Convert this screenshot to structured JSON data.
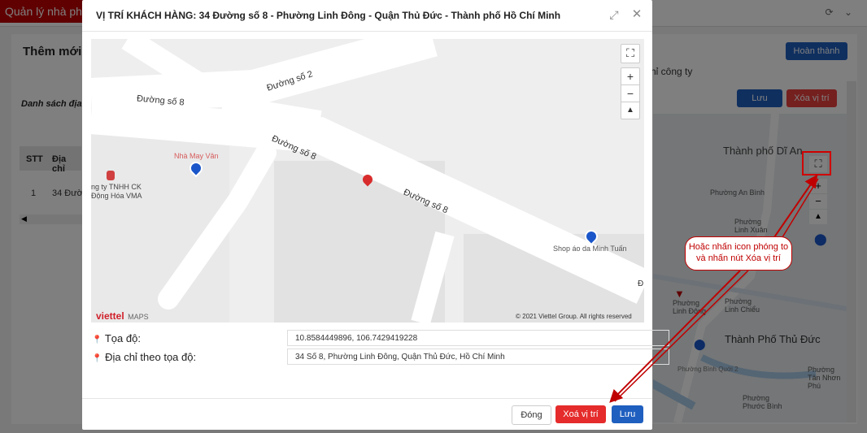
{
  "background": {
    "brand": "Quản lý nhà phân",
    "page_title": "Thêm mới",
    "done_button": "Hoàn thành",
    "company_text": "hỉ công ty",
    "list_label": "Danh sách địa",
    "save_button": "Lưu",
    "delete_button": "Xóa vị trí",
    "table": {
      "headers": [
        "STT",
        "Địa chỉ"
      ],
      "rows": [
        [
          "1",
          "34 Đườ"
        ]
      ]
    },
    "map_labels": [
      "Thành phố Dĩ An",
      "Phường An Bình",
      "Phường Linh Xuân",
      "Phường Linh Đông",
      "Phường Linh Chiểu",
      "Thành Phố Thủ Đức",
      "Phường Tân Nhơn Phú",
      "Phường Phước Bình",
      "Phường Bình Quới 2"
    ]
  },
  "modal": {
    "title": "VỊ TRÍ KHÁCH HÀNG: 34 Đường số 8 - Phường Linh Đông - Quận Thủ Đức - Thành phố Hồ Chí Minh",
    "map": {
      "roads": [
        "Đường số 2",
        "Đường số 8",
        "Đường số 8",
        "Đường số 8"
      ],
      "pois": [
        "Nhà May Vân",
        "ng ty TNHH CK",
        "Động Hóa VMA",
        "Shop áo da Minh Tuấn"
      ],
      "road_edge_letter": "Đ",
      "brand_viettel": "viettel",
      "brand_maps": "MAPS",
      "copyright": "© 2021 Viettel Group. All rights reserved"
    },
    "coords_label": "Tọa độ:",
    "coords_value": "10.8584449896, 106.7429419228",
    "address_label": "Địa chỉ theo tọa độ:",
    "address_value": "34 Số 8, Phường Linh Đông, Quận Thủ Đức, Hồ Chí Minh",
    "buttons": {
      "close": "Đóng",
      "delete": "Xoá vị trí",
      "save": "Lưu"
    }
  },
  "annotation": {
    "text": "Hoặc nhấn icon phóng to và nhấn nút Xóa vị trí"
  },
  "colors": {
    "brand_red": "#c00000",
    "primary": "#1f5fbf",
    "danger": "#e8403e",
    "map_bg": "#eeeeee",
    "road": "#ffffff"
  }
}
